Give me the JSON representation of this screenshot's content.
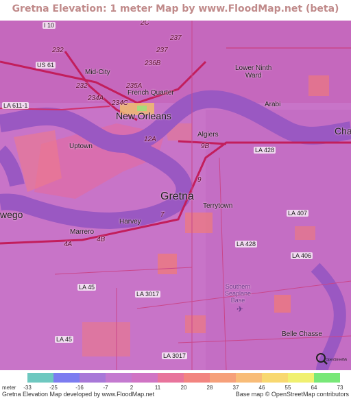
{
  "title": "Gretna Elevation: 1 meter Map by www.FloodMap.net (beta)",
  "map": {
    "labels": [
      {
        "id": "i10",
        "text": "I 10",
        "kind": "shield"
      },
      {
        "id": "sc",
        "text": "2C",
        "kind": "route"
      },
      {
        "id": "r237a",
        "text": "237",
        "kind": "route"
      },
      {
        "id": "r232a",
        "text": "232",
        "kind": "route"
      },
      {
        "id": "r237b",
        "text": "237",
        "kind": "route"
      },
      {
        "id": "us61",
        "text": "US 61",
        "kind": "shield"
      },
      {
        "id": "midcity",
        "text": "Mid-City",
        "kind": "place"
      },
      {
        "id": "r236b",
        "text": "236B",
        "kind": "route"
      },
      {
        "id": "lowerninth",
        "text": "Lower Ninth\nWard",
        "kind": "place"
      },
      {
        "id": "r232b",
        "text": "232",
        "kind": "route"
      },
      {
        "id": "r235a",
        "text": "235A",
        "kind": "route"
      },
      {
        "id": "fq",
        "text": "French Quarter",
        "kind": "place"
      },
      {
        "id": "r234a",
        "text": "234A",
        "kind": "route"
      },
      {
        "id": "la611",
        "text": "LA 611-1",
        "kind": "shield"
      },
      {
        "id": "r234c",
        "text": "234C",
        "kind": "route"
      },
      {
        "id": "arabi",
        "text": "Arabi",
        "kind": "place"
      },
      {
        "id": "neworleans",
        "text": "New Orleans",
        "kind": "city"
      },
      {
        "id": "cha",
        "text": "Cha",
        "kind": "city"
      },
      {
        "id": "algiers",
        "text": "Algiers",
        "kind": "place"
      },
      {
        "id": "r12a",
        "text": "12A",
        "kind": "route"
      },
      {
        "id": "r9b",
        "text": "9B",
        "kind": "route"
      },
      {
        "id": "uptown",
        "text": "Uptown",
        "kind": "place"
      },
      {
        "id": "la428a",
        "text": "LA 428",
        "kind": "shield"
      },
      {
        "id": "r9",
        "text": "9",
        "kind": "route"
      },
      {
        "id": "gretna",
        "text": "Gretna",
        "kind": "big"
      },
      {
        "id": "terrytown",
        "text": "Terrytown",
        "kind": "place"
      },
      {
        "id": "wego",
        "text": "wego",
        "kind": "city"
      },
      {
        "id": "la407",
        "text": "LA 407",
        "kind": "shield"
      },
      {
        "id": "r7",
        "text": "7",
        "kind": "route"
      },
      {
        "id": "harvey",
        "text": "Harvey",
        "kind": "place"
      },
      {
        "id": "marrero",
        "text": "Marrero",
        "kind": "place"
      },
      {
        "id": "r4b",
        "text": "4B",
        "kind": "route"
      },
      {
        "id": "r4a",
        "text": "4A",
        "kind": "route"
      },
      {
        "id": "la428b",
        "text": "LA 428",
        "kind": "shield"
      },
      {
        "id": "la406",
        "text": "LA 406",
        "kind": "shield"
      },
      {
        "id": "la45a",
        "text": "LA 45",
        "kind": "shield"
      },
      {
        "id": "la3017a",
        "text": "LA 3017",
        "kind": "shield"
      },
      {
        "id": "seaplane",
        "text": "Southern\nSeaplane\nBase",
        "kind": "water"
      },
      {
        "id": "la45b",
        "text": "LA 45",
        "kind": "shield"
      },
      {
        "id": "bellechasse",
        "text": "Belle Chasse",
        "kind": "place"
      },
      {
        "id": "la3017b",
        "text": "LA 3017",
        "kind": "shield"
      }
    ]
  },
  "legend": {
    "unit": "meter",
    "ticks": [
      "-33",
      "-25",
      "-16",
      "-7",
      "2",
      "11",
      "20",
      "28",
      "37",
      "46",
      "55",
      "64",
      "73"
    ],
    "colors": [
      "#6ec8c0",
      "#7c7cf0",
      "#a878d8",
      "#c47ad0",
      "#d074c4",
      "#e8749c",
      "#f28480",
      "#f6a07a",
      "#f8bc78",
      "#f8d870",
      "#f0f070",
      "#78e878",
      "#7ce07c"
    ]
  },
  "footer": {
    "left": "Gretna Elevation Map developed by www.FloodMap.net",
    "right": "Base map © OpenStreetMap contributors"
  },
  "logo": {
    "text": "OpenStreetMap"
  }
}
